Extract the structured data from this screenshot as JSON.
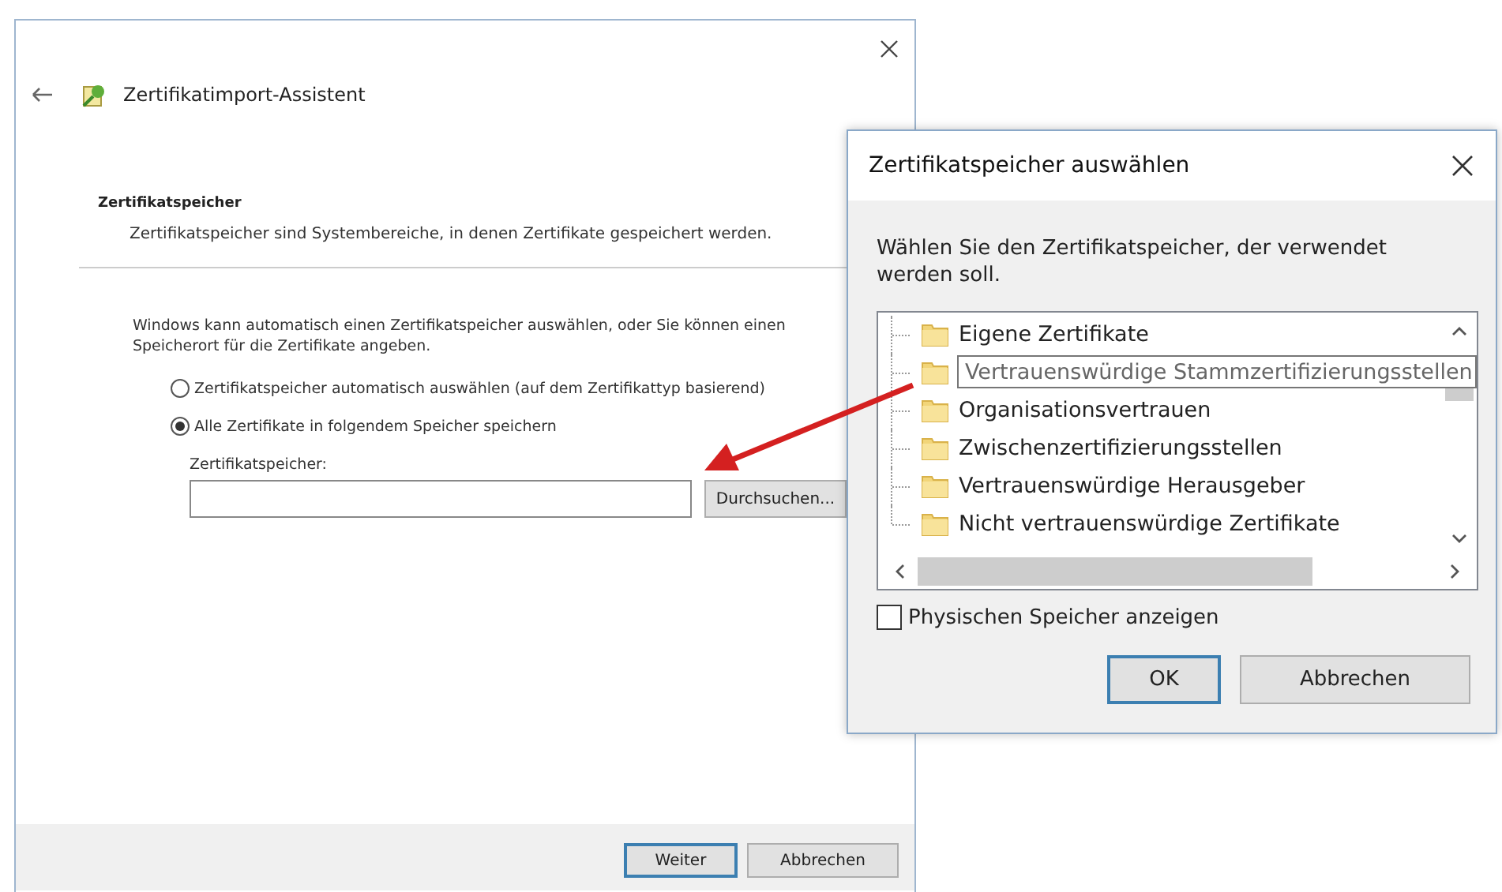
{
  "wizard": {
    "title": "Zertifikatimport-Assistent",
    "section": {
      "heading": "Zertifikatspeicher",
      "description": "Zertifikatspeicher sind Systembereiche, in denen Zertifikate gespeichert werden."
    },
    "intro": "Windows kann automatisch einen Zertifikatspeicher auswählen, oder Sie können einen Speicherort für die Zertifikate angeben.",
    "options": [
      {
        "label": "Zertifikatspeicher automatisch auswählen (auf dem Zertifikattyp basierend)",
        "selected": false
      },
      {
        "label": "Alle Zertifikate in folgendem Speicher speichern",
        "selected": true
      }
    ],
    "store_field": {
      "label": "Zertifikatspeicher:",
      "browse_button": "Durchsuchen..."
    },
    "buttons": [
      {
        "label": "Weiter",
        "default": true
      },
      {
        "label": "Abbrechen",
        "default": false
      }
    ]
  },
  "dialog": {
    "title": "Zertifikatspeicher auswählen",
    "prompt": "Wählen Sie den Zertifikatspeicher, der verwendet werden soll.",
    "tree": [
      {
        "label": "Eigene Zertifikate",
        "hovered": false
      },
      {
        "label": "Vertrauenswürdige Stammzertifizierungsstellen",
        "hovered": true
      },
      {
        "label": "Organisationsvertrauen",
        "hovered": false
      },
      {
        "label": "Zwischenzertifizierungsstellen",
        "hovered": false
      },
      {
        "label": "Vertrauenswürdige Herausgeber",
        "hovered": false
      },
      {
        "label": "Nicht vertrauenswürdige Zertifikate",
        "hovered": false
      }
    ],
    "show_physical": {
      "label": "Physischen Speicher anzeigen",
      "checked": false
    },
    "buttons": [
      {
        "label": "OK",
        "default": true
      },
      {
        "label": "Abbrechen",
        "default": false
      }
    ]
  }
}
